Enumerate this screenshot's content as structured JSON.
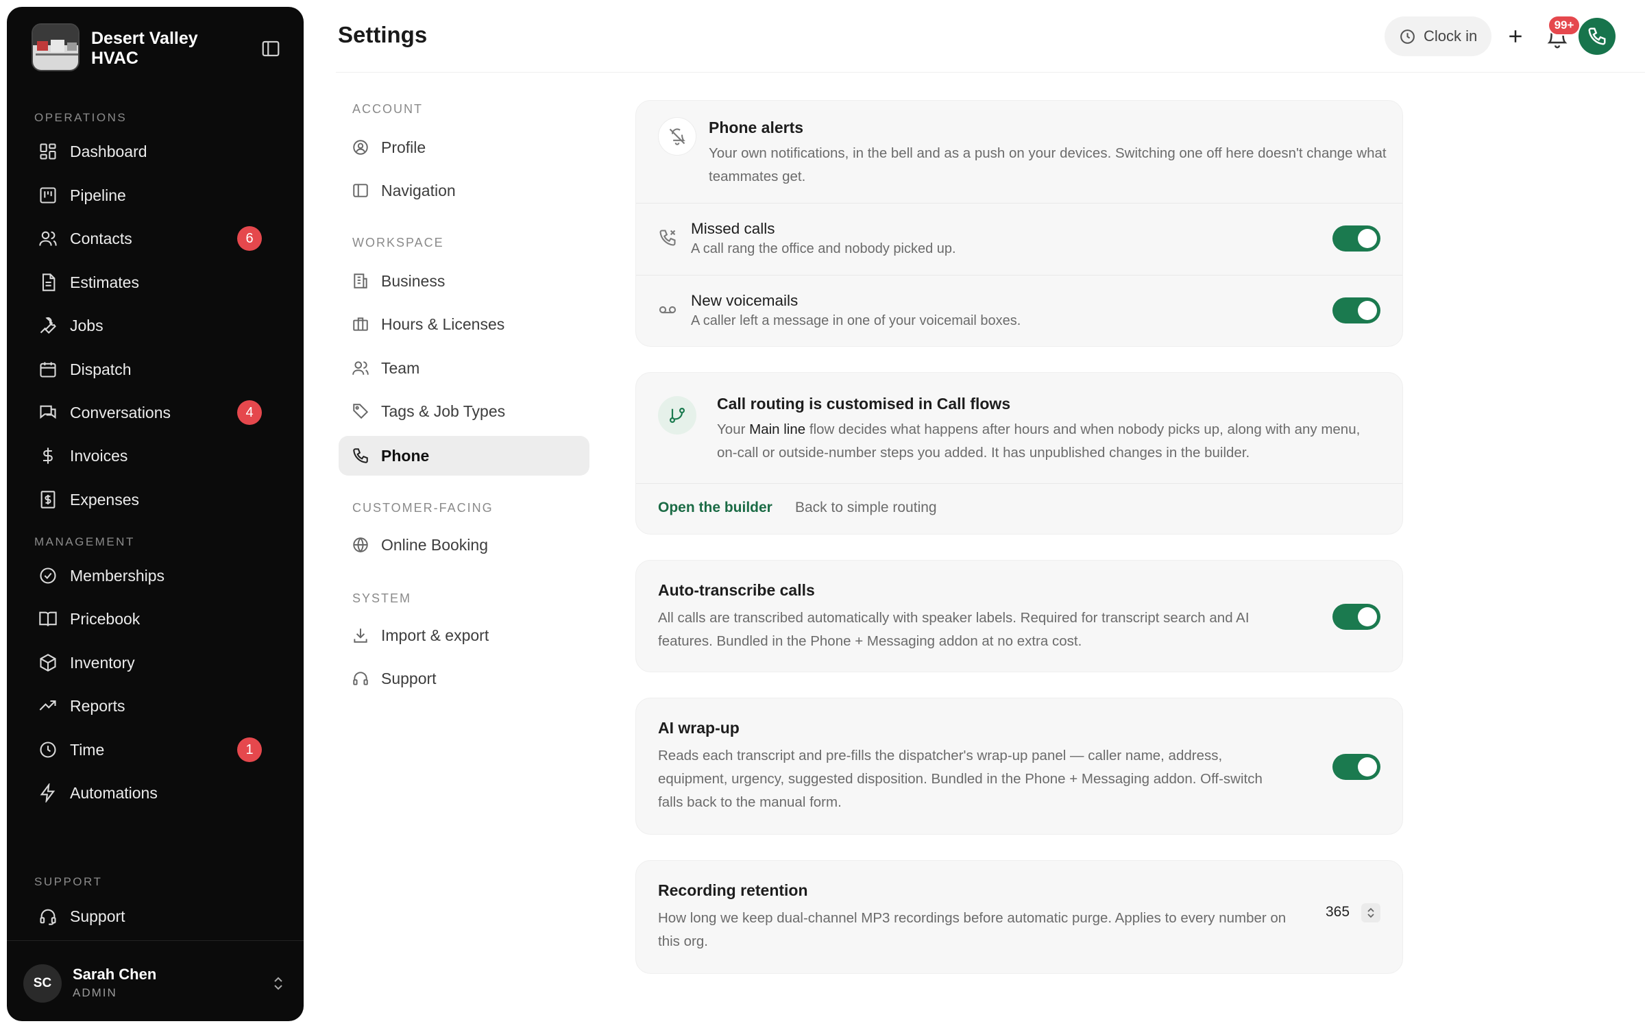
{
  "brand": {
    "name": "Desert Valley HVAC"
  },
  "sidebar": {
    "sections": {
      "operations": "OPERATIONS",
      "management": "MANAGEMENT",
      "support": "SUPPORT"
    },
    "items": [
      {
        "label": "Dashboard",
        "icon": "grid-icon"
      },
      {
        "label": "Pipeline",
        "icon": "kanban-icon"
      },
      {
        "label": "Contacts",
        "icon": "users-icon",
        "badge": "6"
      },
      {
        "label": "Estimates",
        "icon": "document-icon"
      },
      {
        "label": "Jobs",
        "icon": "wrench-icon"
      },
      {
        "label": "Dispatch",
        "icon": "calendar-icon"
      },
      {
        "label": "Conversations",
        "icon": "chat-icon",
        "badge": "4"
      },
      {
        "label": "Invoices",
        "icon": "dollar-icon"
      },
      {
        "label": "Expenses",
        "icon": "receipt-icon"
      },
      {
        "label": "Memberships",
        "icon": "badge-check-icon"
      },
      {
        "label": "Pricebook",
        "icon": "book-icon"
      },
      {
        "label": "Inventory",
        "icon": "box-icon"
      },
      {
        "label": "Reports",
        "icon": "trending-icon"
      },
      {
        "label": "Time",
        "icon": "clock-icon",
        "badge": "1"
      },
      {
        "label": "Automations",
        "icon": "bolt-icon"
      },
      {
        "label": "Support",
        "icon": "headset-icon"
      }
    ],
    "user": {
      "initials": "SC",
      "name": "Sarah Chen",
      "role": "ADMIN"
    }
  },
  "header": {
    "title": "Settings",
    "clock_in": "Clock in",
    "notifications_badge": "99+"
  },
  "settings_nav": {
    "sections": {
      "account": "ACCOUNT",
      "workspace": "WORKSPACE",
      "customer_facing": "CUSTOMER-FACING",
      "system": "SYSTEM"
    },
    "items": [
      {
        "label": "Profile",
        "icon": "user-circle-icon"
      },
      {
        "label": "Navigation",
        "icon": "sidebar-icon"
      },
      {
        "label": "Business",
        "icon": "building-icon"
      },
      {
        "label": "Hours & Licenses",
        "icon": "briefcase-icon"
      },
      {
        "label": "Team",
        "icon": "team-icon"
      },
      {
        "label": "Tags & Job Types",
        "icon": "tag-icon"
      },
      {
        "label": "Phone",
        "icon": "phone-icon",
        "active": true
      },
      {
        "label": "Online Booking",
        "icon": "globe-icon"
      },
      {
        "label": "Import & export",
        "icon": "download-icon"
      },
      {
        "label": "Support",
        "icon": "headset-icon"
      }
    ]
  },
  "phone_alerts": {
    "title": "Phone alerts",
    "description": "Your own notifications, in the bell and as a push on your devices. Switching one off here doesn't change what teammates get.",
    "rows": [
      {
        "title": "Missed calls",
        "description": "A call rang the office and nobody picked up.",
        "enabled": true
      },
      {
        "title": "New voicemails",
        "description": "A caller left a message in one of your voicemail boxes.",
        "enabled": true
      }
    ]
  },
  "call_routing": {
    "title": "Call routing is customised in Call flows",
    "desc_prefix": "Your ",
    "desc_strong": "Main line",
    "desc_rest": " flow decides what happens after hours and when nobody picks up, along with any menu, on-call or outside-number steps you added. It has unpublished changes in the builder.",
    "open_builder": "Open the builder",
    "back_simple": "Back to simple routing"
  },
  "auto_transcribe": {
    "title": "Auto-transcribe calls",
    "description": "All calls are transcribed automatically with speaker labels. Required for transcript search and AI features. Bundled in the Phone + Messaging addon at no extra cost.",
    "enabled": true
  },
  "ai_wrapup": {
    "title": "AI wrap-up",
    "description": "Reads each transcript and pre-fills the dispatcher's wrap-up panel — caller name, address, equipment, urgency, suggested disposition. Bundled in the Phone + Messaging addon. Off-switch falls back to the manual form.",
    "enabled": true
  },
  "recording_retention": {
    "title": "Recording retention",
    "description": "How long we keep dual-channel MP3 recordings before automatic purge. Applies to every number on this org.",
    "value": "365"
  },
  "colors": {
    "accent_green": "#1b7a4f",
    "badge_red": "#e5484d",
    "sidebar_bg": "#0b0b0b"
  }
}
